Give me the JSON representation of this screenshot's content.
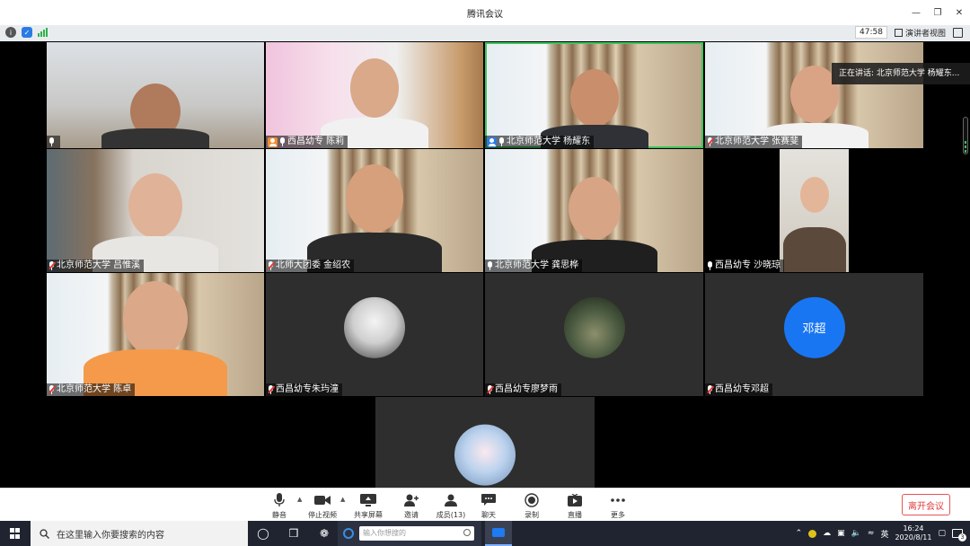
{
  "window": {
    "title": "腾讯会议"
  },
  "infobar": {
    "timer": "47:58",
    "view_label": "演讲者视图"
  },
  "speaking": {
    "text": "正在讲话: 北京师范大学 杨耀东..."
  },
  "participants": [
    {
      "name": "",
      "mic": "on",
      "host": "none",
      "video": true
    },
    {
      "name": "西昌幼专  陈莉",
      "mic": "on",
      "host": "orange",
      "video": true
    },
    {
      "name": "北京师范大学 杨耀东",
      "mic": "on",
      "host": "blue",
      "video": true
    },
    {
      "name": "北京师范大学 张赛斐",
      "mic": "off",
      "host": "none",
      "video": true
    },
    {
      "name": "北京师范大学 吕惟溪",
      "mic": "off",
      "host": "none",
      "video": true
    },
    {
      "name": "北师大团委 金绍农",
      "mic": "off",
      "host": "none",
      "video": true
    },
    {
      "name": "北京师范大学 龚思桦",
      "mic": "on",
      "host": "none",
      "video": true
    },
    {
      "name": "西昌幼专 沙晓琼",
      "mic": "on",
      "host": "none",
      "video": true
    },
    {
      "name": "北京师范大学 陈卓",
      "mic": "off",
      "host": "none",
      "video": true
    },
    {
      "name": "西昌幼专朱玙潼",
      "mic": "off",
      "host": "none",
      "video": false
    },
    {
      "name": "西昌幼专廖梦雨",
      "mic": "off",
      "host": "none",
      "video": false
    },
    {
      "name": "西昌幼专邓超",
      "mic": "off",
      "host": "none",
      "video": false,
      "avatar_text": "邓超"
    },
    {
      "name": "",
      "mic": "off",
      "host": "none",
      "video": false
    }
  ],
  "toolbar": {
    "mute": "静音",
    "stop_video": "停止视频",
    "share_screen": "共享屏幕",
    "invite": "邀请",
    "members": "成员(13)",
    "chat": "聊天",
    "record": "录制",
    "live": "直播",
    "more": "更多",
    "leave": "离开会议"
  },
  "taskbar": {
    "search_placeholder": "在这里输入你要搜索的内容",
    "browser_placeholder": "输入你想搜的",
    "ime": "英",
    "time": "16:24",
    "date": "2020/8/11",
    "notifications": "3"
  },
  "colors": {
    "accent": "#1876f2",
    "speaking_border": "#3ec35c",
    "leave": "#e03b3b",
    "host_orange": "#f08c2a"
  }
}
